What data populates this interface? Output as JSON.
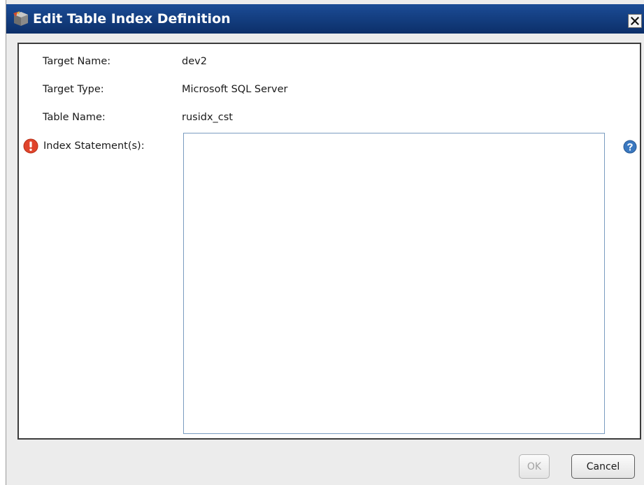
{
  "dialog": {
    "title": "Edit Table Index Definition",
    "close_symbol": "×"
  },
  "fields": {
    "target_name_label": "Target Name:",
    "target_name_value": "dev2",
    "target_type_label": "Target Type:",
    "target_type_value": "Microsoft SQL Server",
    "table_name_label": "Table Name:",
    "table_name_value": "rusidx_cst",
    "index_statements_label": "Index Statement(s):",
    "index_statements_value": ""
  },
  "buttons": {
    "ok_label": "OK",
    "cancel_label": "Cancel",
    "ok_enabled": false
  },
  "icons": {
    "title": "database-icon",
    "error": "error-exclamation-icon",
    "help": "help-question-icon",
    "close": "close-icon"
  },
  "colors": {
    "titlebar": "#0c2f69",
    "error": "#e0442c",
    "help": "#3a78c0",
    "textarea_border": "#7a9cc0"
  }
}
